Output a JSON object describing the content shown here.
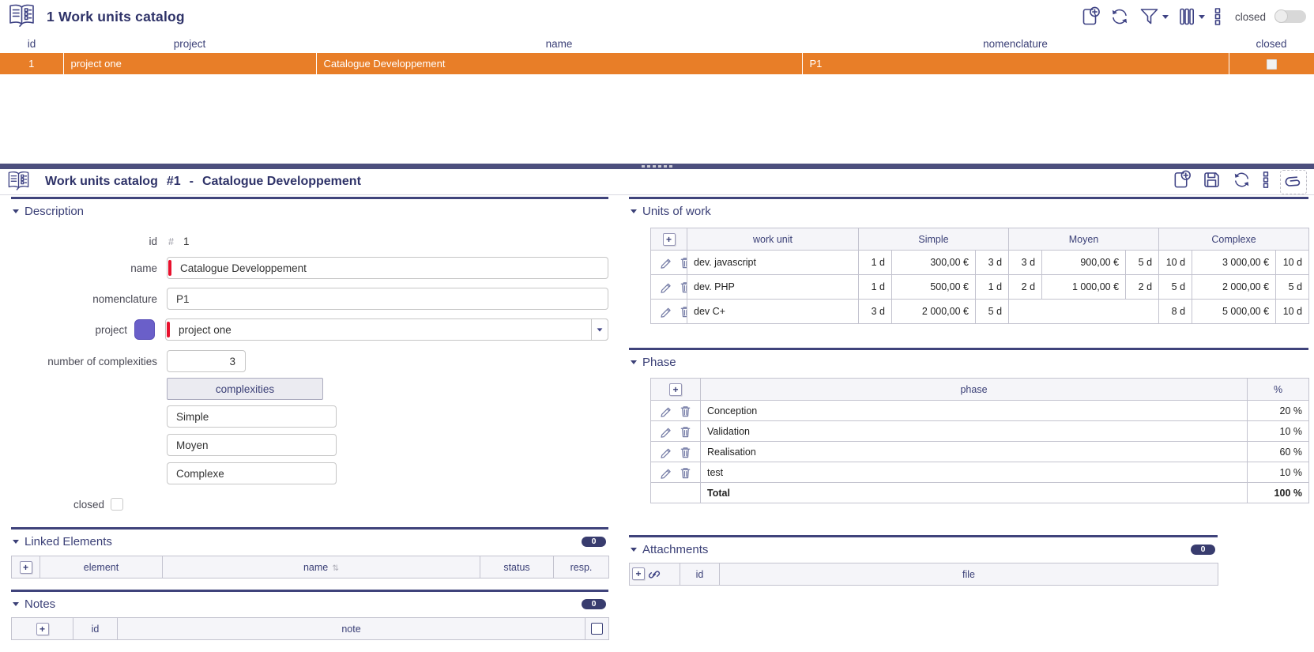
{
  "colors": {
    "accent_orange": "#E87E28",
    "navy": "#3B4077",
    "section_line": "#3F437B",
    "badge_bg": "#383C6E",
    "required_red": "#E8112D",
    "project_swatch_purple": "#6A5FC9",
    "splitter_bar": "#4C4F7D",
    "disabled_cell": "#E4E4E4"
  },
  "list_panel": {
    "title": "1 Work units catalog",
    "toolbar": {
      "icons": [
        "add",
        "refresh",
        "filter",
        "columns",
        "menu"
      ],
      "closed_label": "closed",
      "closed_toggle_state": "off"
    },
    "columns": [
      "id",
      "project",
      "name",
      "nomenclature",
      "closed"
    ],
    "row": {
      "id": "1",
      "project": "project one",
      "name": "Catalogue Developpement",
      "nomenclature": "P1",
      "closed": false
    }
  },
  "detail_panel": {
    "title_prefix": "Work units catalog",
    "record_id": "#1",
    "dash": "-",
    "record_name": "Catalogue Developpement",
    "toolbar_icons": [
      "add",
      "save",
      "refresh",
      "menu",
      "attachment"
    ],
    "description": {
      "section_title": "Description",
      "id_label": "id",
      "id_hash": "#",
      "id_value": "1",
      "name_label": "name",
      "name_value": "Catalogue Developpement",
      "nomenclature_label": "nomenclature",
      "nomenclature_value": "P1",
      "project_label": "project",
      "project_value": "project one",
      "complexity_count_label": "number of complexities",
      "complexity_count_value": "3",
      "complexities_header": "complexities",
      "complexities": [
        "Simple",
        "Moyen",
        "Complexe"
      ],
      "closed_label": "closed",
      "closed_checked": false
    },
    "units_of_work": {
      "section_title": "Units of work",
      "add_label": "+",
      "work_unit_header": "work unit",
      "groups": [
        "Simple",
        "Moyen",
        "Complexe"
      ],
      "rows": [
        {
          "name": "dev. javascript",
          "values": [
            "1 d",
            "300,00 €",
            "3 d",
            "3 d",
            "900,00 €",
            "5 d",
            "10 d",
            "3 000,00 €",
            "10 d"
          ]
        },
        {
          "name": "dev. PHP",
          "values": [
            "1 d",
            "500,00 €",
            "1 d",
            "2 d",
            "1 000,00 €",
            "2 d",
            "5 d",
            "2 000,00 €",
            "5 d"
          ]
        },
        {
          "name": "dev C+",
          "values": [
            "3 d",
            "2 000,00 €",
            "5 d",
            "8 d",
            "5 000,00 €",
            "10 d"
          ]
        }
      ]
    },
    "phase": {
      "section_title": "Phase",
      "add_label": "+",
      "phase_header": "phase",
      "percent_header": "%",
      "rows": [
        {
          "phase": "Conception",
          "percent": "20 %"
        },
        {
          "phase": "Validation",
          "percent": "10 %"
        },
        {
          "phase": "Realisation",
          "percent": "60 %"
        },
        {
          "phase": "test",
          "percent": "10 %"
        }
      ],
      "total_label": "Total",
      "total_value": "100 %"
    },
    "linked_elements": {
      "section_title": "Linked Elements",
      "badge": "0",
      "add_label": "+",
      "columns": {
        "element": "element",
        "name": "name",
        "sort_glyph": "⇅",
        "status": "status",
        "resp": "resp."
      }
    },
    "attachments": {
      "section_title": "Attachments",
      "badge": "0",
      "add_label": "+",
      "columns": {
        "id": "id",
        "file": "file"
      }
    },
    "notes": {
      "section_title": "Notes",
      "badge": "0",
      "add_label": "+",
      "columns": {
        "id": "id",
        "note": "note"
      }
    }
  }
}
